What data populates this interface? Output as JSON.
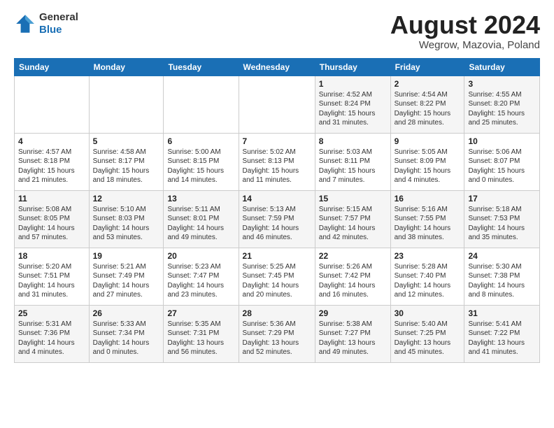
{
  "header": {
    "logo_general": "General",
    "logo_blue": "Blue",
    "month_title": "August 2024",
    "subtitle": "Wegrow, Mazovia, Poland"
  },
  "days_of_week": [
    "Sunday",
    "Monday",
    "Tuesday",
    "Wednesday",
    "Thursday",
    "Friday",
    "Saturday"
  ],
  "weeks": [
    [
      {
        "day": "",
        "info": ""
      },
      {
        "day": "",
        "info": ""
      },
      {
        "day": "",
        "info": ""
      },
      {
        "day": "",
        "info": ""
      },
      {
        "day": "1",
        "info": "Sunrise: 4:52 AM\nSunset: 8:24 PM\nDaylight: 15 hours\nand 31 minutes."
      },
      {
        "day": "2",
        "info": "Sunrise: 4:54 AM\nSunset: 8:22 PM\nDaylight: 15 hours\nand 28 minutes."
      },
      {
        "day": "3",
        "info": "Sunrise: 4:55 AM\nSunset: 8:20 PM\nDaylight: 15 hours\nand 25 minutes."
      }
    ],
    [
      {
        "day": "4",
        "info": "Sunrise: 4:57 AM\nSunset: 8:18 PM\nDaylight: 15 hours\nand 21 minutes."
      },
      {
        "day": "5",
        "info": "Sunrise: 4:58 AM\nSunset: 8:17 PM\nDaylight: 15 hours\nand 18 minutes."
      },
      {
        "day": "6",
        "info": "Sunrise: 5:00 AM\nSunset: 8:15 PM\nDaylight: 15 hours\nand 14 minutes."
      },
      {
        "day": "7",
        "info": "Sunrise: 5:02 AM\nSunset: 8:13 PM\nDaylight: 15 hours\nand 11 minutes."
      },
      {
        "day": "8",
        "info": "Sunrise: 5:03 AM\nSunset: 8:11 PM\nDaylight: 15 hours\nand 7 minutes."
      },
      {
        "day": "9",
        "info": "Sunrise: 5:05 AM\nSunset: 8:09 PM\nDaylight: 15 hours\nand 4 minutes."
      },
      {
        "day": "10",
        "info": "Sunrise: 5:06 AM\nSunset: 8:07 PM\nDaylight: 15 hours\nand 0 minutes."
      }
    ],
    [
      {
        "day": "11",
        "info": "Sunrise: 5:08 AM\nSunset: 8:05 PM\nDaylight: 14 hours\nand 57 minutes."
      },
      {
        "day": "12",
        "info": "Sunrise: 5:10 AM\nSunset: 8:03 PM\nDaylight: 14 hours\nand 53 minutes."
      },
      {
        "day": "13",
        "info": "Sunrise: 5:11 AM\nSunset: 8:01 PM\nDaylight: 14 hours\nand 49 minutes."
      },
      {
        "day": "14",
        "info": "Sunrise: 5:13 AM\nSunset: 7:59 PM\nDaylight: 14 hours\nand 46 minutes."
      },
      {
        "day": "15",
        "info": "Sunrise: 5:15 AM\nSunset: 7:57 PM\nDaylight: 14 hours\nand 42 minutes."
      },
      {
        "day": "16",
        "info": "Sunrise: 5:16 AM\nSunset: 7:55 PM\nDaylight: 14 hours\nand 38 minutes."
      },
      {
        "day": "17",
        "info": "Sunrise: 5:18 AM\nSunset: 7:53 PM\nDaylight: 14 hours\nand 35 minutes."
      }
    ],
    [
      {
        "day": "18",
        "info": "Sunrise: 5:20 AM\nSunset: 7:51 PM\nDaylight: 14 hours\nand 31 minutes."
      },
      {
        "day": "19",
        "info": "Sunrise: 5:21 AM\nSunset: 7:49 PM\nDaylight: 14 hours\nand 27 minutes."
      },
      {
        "day": "20",
        "info": "Sunrise: 5:23 AM\nSunset: 7:47 PM\nDaylight: 14 hours\nand 23 minutes."
      },
      {
        "day": "21",
        "info": "Sunrise: 5:25 AM\nSunset: 7:45 PM\nDaylight: 14 hours\nand 20 minutes."
      },
      {
        "day": "22",
        "info": "Sunrise: 5:26 AM\nSunset: 7:42 PM\nDaylight: 14 hours\nand 16 minutes."
      },
      {
        "day": "23",
        "info": "Sunrise: 5:28 AM\nSunset: 7:40 PM\nDaylight: 14 hours\nand 12 minutes."
      },
      {
        "day": "24",
        "info": "Sunrise: 5:30 AM\nSunset: 7:38 PM\nDaylight: 14 hours\nand 8 minutes."
      }
    ],
    [
      {
        "day": "25",
        "info": "Sunrise: 5:31 AM\nSunset: 7:36 PM\nDaylight: 14 hours\nand 4 minutes."
      },
      {
        "day": "26",
        "info": "Sunrise: 5:33 AM\nSunset: 7:34 PM\nDaylight: 14 hours\nand 0 minutes."
      },
      {
        "day": "27",
        "info": "Sunrise: 5:35 AM\nSunset: 7:31 PM\nDaylight: 13 hours\nand 56 minutes."
      },
      {
        "day": "28",
        "info": "Sunrise: 5:36 AM\nSunset: 7:29 PM\nDaylight: 13 hours\nand 52 minutes."
      },
      {
        "day": "29",
        "info": "Sunrise: 5:38 AM\nSunset: 7:27 PM\nDaylight: 13 hours\nand 49 minutes."
      },
      {
        "day": "30",
        "info": "Sunrise: 5:40 AM\nSunset: 7:25 PM\nDaylight: 13 hours\nand 45 minutes."
      },
      {
        "day": "31",
        "info": "Sunrise: 5:41 AM\nSunset: 7:22 PM\nDaylight: 13 hours\nand 41 minutes."
      }
    ]
  ]
}
